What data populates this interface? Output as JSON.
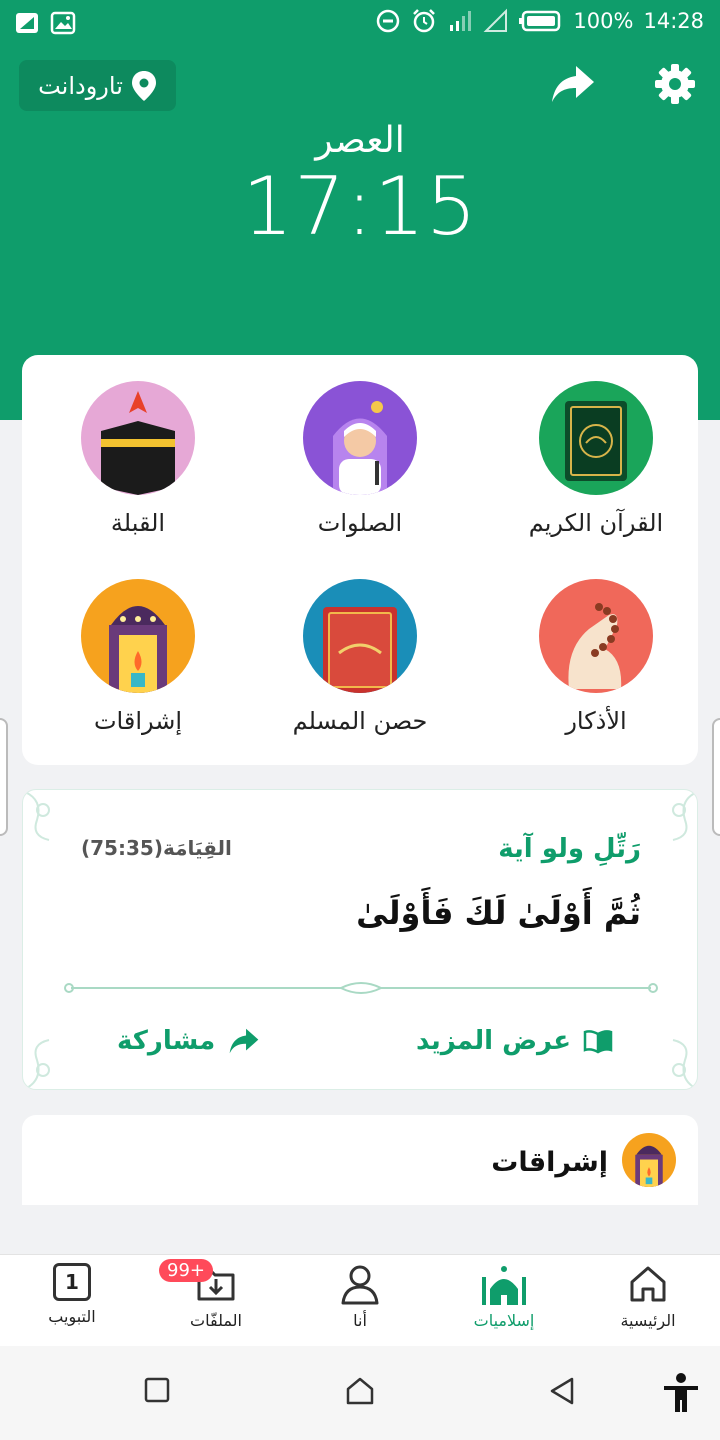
{
  "status_bar": {
    "battery": "100%",
    "time": "14:28",
    "left_icons": [
      "signal-icon",
      "gallery-icon"
    ],
    "right_icons": [
      "do-not-disturb-icon",
      "alarm-icon",
      "cellular-signal-icon",
      "no-sim-signal-icon",
      "battery-icon"
    ]
  },
  "header": {
    "location": "تارودانت",
    "prayer_name": "العصر",
    "prayer_time": "17:15",
    "accent_color": "#0f9d6b"
  },
  "grid": {
    "items": [
      {
        "label": "القرآن الكريم",
        "icon": "quran-icon"
      },
      {
        "label": "الصلوات",
        "icon": "prayers-icon"
      },
      {
        "label": "القبلة",
        "icon": "qibla-icon"
      },
      {
        "label": "الأذكار",
        "icon": "dhikr-icon"
      },
      {
        "label": "حصن المسلم",
        "icon": "hisn-muslim-icon"
      },
      {
        "label": "إشراقات",
        "icon": "ishraqat-icon"
      }
    ]
  },
  "verse": {
    "title": "رَتِّلِ ولو آية",
    "reference": "القِيَامَة(75:35)",
    "text": "ثُمَّ أَوْلَىٰ لَكَ فَأَوْلَىٰ",
    "more_label": "عرض المزيد",
    "share_label": "مشاركة"
  },
  "section": {
    "title": "إشراقات",
    "icon": "ishraqat-icon"
  },
  "bottom_nav": {
    "items": [
      {
        "label": "الرئيسية",
        "icon": "home-icon",
        "active": false
      },
      {
        "label": "إسلاميات",
        "icon": "mosque-icon",
        "active": true
      },
      {
        "label": "أنا",
        "icon": "person-icon",
        "active": false
      },
      {
        "label": "الملفّات",
        "icon": "download-folder-icon",
        "active": false
      },
      {
        "label": "التبويب",
        "icon": "tabs-icon",
        "active": false
      }
    ],
    "files_badge": "99+",
    "tabs_count": "1"
  }
}
